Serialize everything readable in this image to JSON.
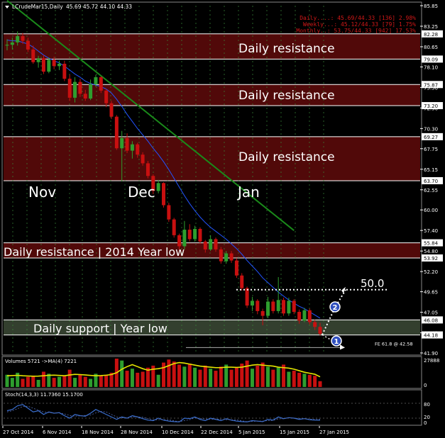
{
  "window": {
    "symbol_title": "LCrudeMar15,Daily",
    "ohlc": "45.69 45.72 44.10 44.33",
    "stats": [
      "Daily....: 45.69/44.33 [136] 2.98%",
      "Weekly...: 45.12/44.33 [79] 1.75%",
      "Monthly..: 53.75/44.33 [942] 17.53%"
    ]
  },
  "colors": {
    "background": "#000000",
    "resistance_fill": "#5a0a0a",
    "support_fill": "#3c4a36",
    "bull_candle": "#2e9e2e",
    "bear_candle": "#c81010",
    "ma_fast": "#2255ff",
    "ma_slow": "#1a8a1a",
    "stats_text": "#d01818",
    "volume_ma": "#e6e600",
    "stoch_line": "#3a6fd0"
  },
  "zones": [
    {
      "label": "Daily resistance",
      "top": 82.28,
      "bottom": 79.09
    },
    {
      "label": "Daily resistance",
      "top": 75.87,
      "bottom": 73.2
    },
    {
      "label": "Daily resistance",
      "top": 69.27,
      "bottom": 63.7
    },
    {
      "label": "Daily resistance | 2014 Year low",
      "top": 55.84,
      "bottom": 53.92
    },
    {
      "label": "Daily support | Year low",
      "top": 46.08,
      "bottom": 44.18
    }
  ],
  "month_labels": [
    "Nov",
    "Dec",
    "Jan"
  ],
  "annotations": {
    "target_level_label": "50.0",
    "target_level": 49.9,
    "fe_label": "FE 61.8 @ 42.58",
    "fe_level": 42.58,
    "wave_markers": [
      "1",
      "2"
    ]
  },
  "price_axis": {
    "ticks": [
      "85.85",
      "83.25",
      "80.65",
      "78.10",
      "75.50",
      "72.90",
      "70.30",
      "67.75",
      "65.15",
      "62.55",
      "60.00",
      "57.40",
      "54.80",
      "52.20",
      "49.65",
      "47.05",
      "44.45",
      "41.90"
    ],
    "highlighted": [
      "82.28",
      "79.09",
      "75.87",
      "73.20",
      "69.27",
      "63.70",
      "55.84",
      "53.92",
      "46.08",
      "44.18"
    ]
  },
  "volume_panel": {
    "title": "Volumes 5721  ->MA(4) 7221",
    "ticks": [
      "27888",
      "0"
    ]
  },
  "stoch_panel": {
    "title": "Stoch(14,3,3) 11.7360 15.1700",
    "ticks": [
      "80",
      "20",
      "0"
    ]
  },
  "date_axis": [
    "27 Oct 2014",
    "6 Nov 2014",
    "18 Nov 2014",
    "28 Nov 2014",
    "10 Dec 2014",
    "22 Dec 2014",
    "5 Jan 2015",
    "15 Jan 2015",
    "27 Jan 2015"
  ],
  "chart_data": {
    "type": "candlestick",
    "ylim": [
      41.9,
      85.85
    ],
    "candles": [
      [
        80.8,
        81.6,
        80.2,
        80.9
      ],
      [
        80.9,
        81.8,
        80.3,
        81.2
      ],
      [
        81.2,
        82.6,
        80.8,
        82.0
      ],
      [
        82.0,
        82.4,
        81.0,
        81.4
      ],
      [
        81.4,
        81.8,
        80.0,
        80.3
      ],
      [
        80.3,
        80.8,
        78.5,
        78.7
      ],
      [
        78.7,
        79.5,
        78.0,
        79.2
      ],
      [
        79.2,
        79.6,
        77.2,
        77.5
      ],
      [
        77.5,
        79.3,
        77.3,
        79.0
      ],
      [
        79.0,
        79.4,
        77.8,
        78.2
      ],
      [
        78.2,
        78.9,
        77.7,
        78.5
      ],
      [
        78.5,
        78.9,
        76.3,
        76.6
      ],
      [
        76.6,
        77.1,
        73.8,
        74.2
      ],
      [
        74.2,
        76.8,
        73.6,
        76.2
      ],
      [
        76.2,
        76.6,
        74.3,
        74.7
      ],
      [
        74.7,
        75.2,
        73.8,
        74.1
      ],
      [
        74.1,
        76.5,
        73.9,
        75.9
      ],
      [
        75.9,
        77.1,
        75.6,
        76.8
      ],
      [
        76.8,
        76.9,
        74.8,
        75.1
      ],
      [
        75.1,
        75.3,
        73.0,
        73.5
      ],
      [
        73.5,
        73.8,
        71.5,
        71.8
      ],
      [
        71.8,
        72.0,
        67.6,
        67.8
      ],
      [
        67.8,
        70.0,
        63.6,
        69.1
      ],
      [
        69.1,
        69.7,
        67.2,
        67.5
      ],
      [
        67.5,
        68.7,
        66.5,
        68.3
      ],
      [
        68.3,
        68.5,
        66.6,
        67.0
      ],
      [
        67.0,
        67.3,
        65.6,
        65.9
      ],
      [
        65.9,
        66.2,
        64.0,
        64.3
      ],
      [
        64.3,
        64.5,
        62.0,
        62.4
      ],
      [
        62.4,
        63.8,
        62.1,
        63.4
      ],
      [
        63.4,
        63.5,
        60.3,
        60.6
      ],
      [
        60.6,
        60.9,
        58.5,
        58.8
      ],
      [
        58.8,
        59.0,
        56.5,
        56.8
      ],
      [
        56.8,
        57.0,
        55.0,
        55.4
      ],
      [
        55.4,
        58.6,
        55.0,
        57.5
      ],
      [
        57.5,
        58.2,
        56.0,
        56.3
      ],
      [
        56.3,
        58.0,
        56.0,
        57.6
      ],
      [
        57.6,
        57.8,
        55.7,
        56.0
      ],
      [
        56.0,
        56.2,
        54.6,
        55.0
      ],
      [
        55.0,
        56.8,
        54.8,
        56.3
      ],
      [
        56.3,
        56.5,
        54.7,
        55.0
      ],
      [
        55.0,
        55.3,
        53.2,
        53.5
      ],
      [
        53.5,
        54.8,
        53.2,
        54.5
      ],
      [
        54.5,
        54.8,
        53.3,
        53.6
      ],
      [
        53.6,
        53.9,
        51.4,
        51.7
      ],
      [
        51.7,
        52.0,
        49.8,
        50.1
      ],
      [
        50.1,
        50.3,
        47.6,
        47.9
      ],
      [
        47.9,
        49.0,
        47.2,
        48.5
      ],
      [
        48.5,
        48.7,
        46.8,
        47.2
      ],
      [
        47.2,
        47.5,
        45.4,
        46.6
      ],
      [
        46.6,
        49.0,
        46.3,
        48.4
      ],
      [
        48.4,
        48.7,
        46.9,
        47.2
      ],
      [
        47.2,
        51.5,
        46.9,
        48.6
      ],
      [
        48.6,
        48.9,
        46.6,
        46.9
      ],
      [
        46.9,
        48.9,
        46.6,
        48.5
      ],
      [
        48.5,
        48.7,
        46.8,
        47.1
      ],
      [
        47.1,
        47.4,
        45.6,
        46.0
      ],
      [
        46.0,
        47.6,
        45.8,
        47.3
      ],
      [
        47.3,
        47.5,
        45.5,
        45.8
      ],
      [
        45.8,
        46.1,
        44.8,
        45.2
      ],
      [
        45.2,
        45.7,
        44.1,
        44.33
      ]
    ],
    "volume": [
      12000,
      9000,
      14000,
      8000,
      10000,
      11000,
      7000,
      15000,
      13000,
      9000,
      10000,
      11000,
      17000,
      9000,
      12000,
      10000,
      8000,
      13000,
      11000,
      12000,
      14000,
      27888,
      26000,
      16000,
      18000,
      14000,
      15000,
      19000,
      21000,
      12000,
      24000,
      27000,
      25000,
      22000,
      20000,
      23000,
      19000,
      17000,
      21000,
      18000,
      16000,
      20000,
      22000,
      17000,
      19000,
      23000,
      26000,
      18000,
      21000,
      24000,
      20000,
      17000,
      19000,
      22000,
      15000,
      16000,
      14000,
      13000,
      12000,
      11000,
      5721
    ],
    "volume_ma": [
      11000,
      11200,
      11500,
      11000,
      10800,
      10600,
      10700,
      11000,
      11500,
      11600,
      11400,
      11000,
      11800,
      12400,
      12200,
      11800,
      11400,
      11000,
      11200,
      11600,
      12200,
      14000,
      17500,
      20000,
      22000,
      20000,
      18000,
      16500,
      17500,
      18000,
      19000,
      21000,
      23000,
      24000,
      23500,
      22500,
      21500,
      20500,
      20000,
      19500,
      19000,
      19000,
      19500,
      19500,
      19200,
      19500,
      20500,
      21500,
      22000,
      21500,
      21000,
      20500,
      19500,
      19000,
      18500,
      17500,
      16000,
      14500,
      13500,
      12500,
      10000
    ],
    "stoch": [
      50,
      55,
      70,
      75,
      60,
      45,
      50,
      35,
      45,
      40,
      42,
      30,
      20,
      35,
      30,
      28,
      40,
      55,
      45,
      35,
      25,
      15,
      25,
      20,
      30,
      25,
      18,
      12,
      10,
      20,
      12,
      8,
      6,
      5,
      20,
      18,
      25,
      15,
      10,
      20,
      15,
      10,
      18,
      12,
      8,
      6,
      5,
      10,
      8,
      6,
      15,
      12,
      25,
      18,
      22,
      20,
      15,
      18,
      14,
      12,
      11.7
    ],
    "stoch_signal": [
      45,
      50,
      58,
      67,
      68,
      60,
      52,
      45,
      43,
      40,
      42,
      37,
      31,
      28,
      29,
      31,
      33,
      41,
      47,
      45,
      35,
      25,
      22,
      20,
      25,
      25,
      24,
      18,
      13,
      14,
      14,
      13,
      9,
      6,
      10,
      14,
      21,
      19,
      17,
      15,
      17,
      15,
      14,
      13,
      13,
      9,
      6,
      7,
      8,
      8,
      10,
      11,
      17,
      18,
      22,
      20,
      19,
      18,
      16,
      15,
      15.2
    ],
    "ma_fast": [
      81.5,
      81.4,
      81.4,
      81.2,
      81.0,
      80.6,
      80.1,
      79.6,
      79.2,
      78.9,
      78.6,
      78.2,
      77.7,
      77.2,
      76.8,
      76.3,
      76.0,
      75.8,
      75.6,
      75.3,
      74.8,
      74.0,
      73.1,
      72.1,
      71.2,
      70.3,
      69.5,
      68.7,
      67.8,
      67.0,
      66.1,
      65.1,
      64.0,
      62.9,
      61.8,
      60.8,
      59.9,
      59.1,
      58.4,
      57.8,
      57.3,
      56.8,
      56.3,
      55.7,
      55.1,
      54.4,
      53.6,
      52.9,
      52.2,
      51.4,
      50.8,
      50.2,
      49.6,
      49.1,
      48.6,
      48.2,
      47.8,
      47.5,
      47.1,
      46.7,
      46.3
    ],
    "ma_slow_start_end": [
      [
        0,
        86.5
      ],
      [
        55,
        57.4
      ]
    ]
  }
}
